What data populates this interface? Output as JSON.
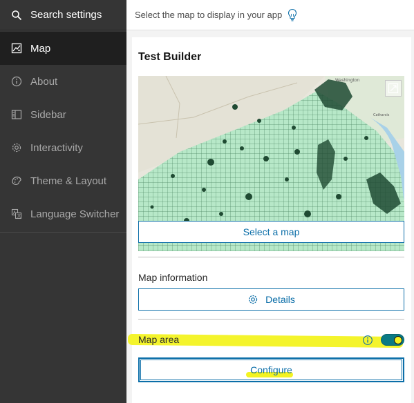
{
  "sidebar": {
    "search_label": "Search settings",
    "items": [
      {
        "label": "Map",
        "icon": "map-icon",
        "active": true
      },
      {
        "label": "About",
        "icon": "info-icon",
        "active": false
      },
      {
        "label": "Sidebar",
        "icon": "sidebar-icon",
        "active": false
      },
      {
        "label": "Interactivity",
        "icon": "gear-icon",
        "active": false
      },
      {
        "label": "Theme & Layout",
        "icon": "palette-icon",
        "active": false
      },
      {
        "label": "Language Switcher",
        "icon": "language-icon",
        "active": false
      }
    ]
  },
  "header": {
    "hint": "Select the map to display in your app",
    "icon": "lightbulb-icon"
  },
  "card": {
    "title": "Test Builder",
    "map_labels": [
      "Washington",
      "Catharsis"
    ],
    "select_map_label": "Select a map",
    "map_info_label": "Map information",
    "details_label": "Details",
    "map_area_label": "Map area",
    "map_area_enabled": true,
    "configure_label": "Configure"
  },
  "colors": {
    "accent": "#0b6ea8",
    "toggle": "#0a7a84",
    "highlight": "#f3f321",
    "sidebar_bg": "#353535",
    "sidebar_active": "#1f1f1f"
  }
}
